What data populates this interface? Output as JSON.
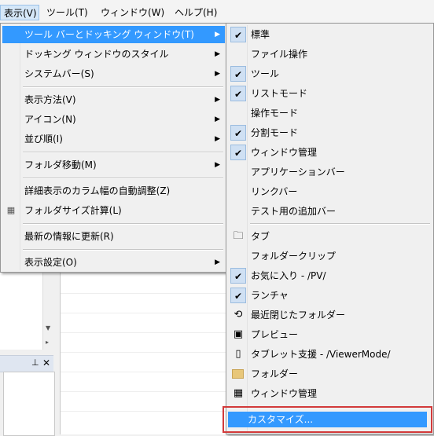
{
  "menubar": {
    "items": [
      "表示(V)",
      "ツール(T)",
      "ウィンドウ(W)",
      "ヘルプ(H)"
    ]
  },
  "main_menu": {
    "items": [
      {
        "label": "ツール バーとドッキング ウィンドウ(T)",
        "submenu": true,
        "highlighted": true
      },
      {
        "label": "ドッキング ウィンドウのスタイル",
        "submenu": true
      },
      {
        "label": "システムバー(S)",
        "submenu": true
      },
      {
        "label": "表示方法(V)",
        "submenu": true
      },
      {
        "label": "アイコン(N)",
        "submenu": true
      },
      {
        "label": "並び順(I)",
        "submenu": true
      },
      {
        "label": "フォルダ移動(M)",
        "submenu": true
      },
      {
        "label": "詳細表示のカラム幅の自動調整(Z)"
      },
      {
        "label": "フォルダサイズ計算(L)",
        "icon": "folder-size-icon"
      },
      {
        "label": "最新の情報に更新(R)"
      },
      {
        "label": "表示設定(O)",
        "submenu": true
      }
    ]
  },
  "sub_menu": {
    "items": [
      {
        "label": "標準",
        "checked": true
      },
      {
        "label": "ファイル操作",
        "checked": false
      },
      {
        "label": "ツール",
        "checked": true
      },
      {
        "label": "リストモード",
        "checked": true
      },
      {
        "label": "操作モード",
        "checked": false
      },
      {
        "label": "分割モード",
        "checked": true
      },
      {
        "label": "ウィンドウ管理",
        "checked": true
      },
      {
        "label": "アプリケーションバー",
        "checked": false
      },
      {
        "label": "リンクバー",
        "checked": false
      },
      {
        "label": "テスト用の追加バー",
        "checked": false
      },
      {
        "label": "タブ",
        "icon": "tab-icon"
      },
      {
        "label": "フォルダークリップ",
        "checked": false
      },
      {
        "label": "お気に入り - /PV/",
        "checked": true
      },
      {
        "label": "ランチャ",
        "checked": true
      },
      {
        "label": "最近閉じたフォルダー",
        "icon": "history-icon"
      },
      {
        "label": "プレビュー",
        "icon": "preview-icon"
      },
      {
        "label": "タブレット支援 - /ViewerMode/",
        "icon": "tablet-icon"
      },
      {
        "label": "フォルダー",
        "icon": "folder-icon"
      },
      {
        "label": "ウィンドウ管理",
        "icon": "window-grid-icon"
      }
    ],
    "customize": "カスタマイズ..."
  },
  "colors": {
    "highlight": "#3399ff",
    "annotation": "#d23a3a"
  }
}
